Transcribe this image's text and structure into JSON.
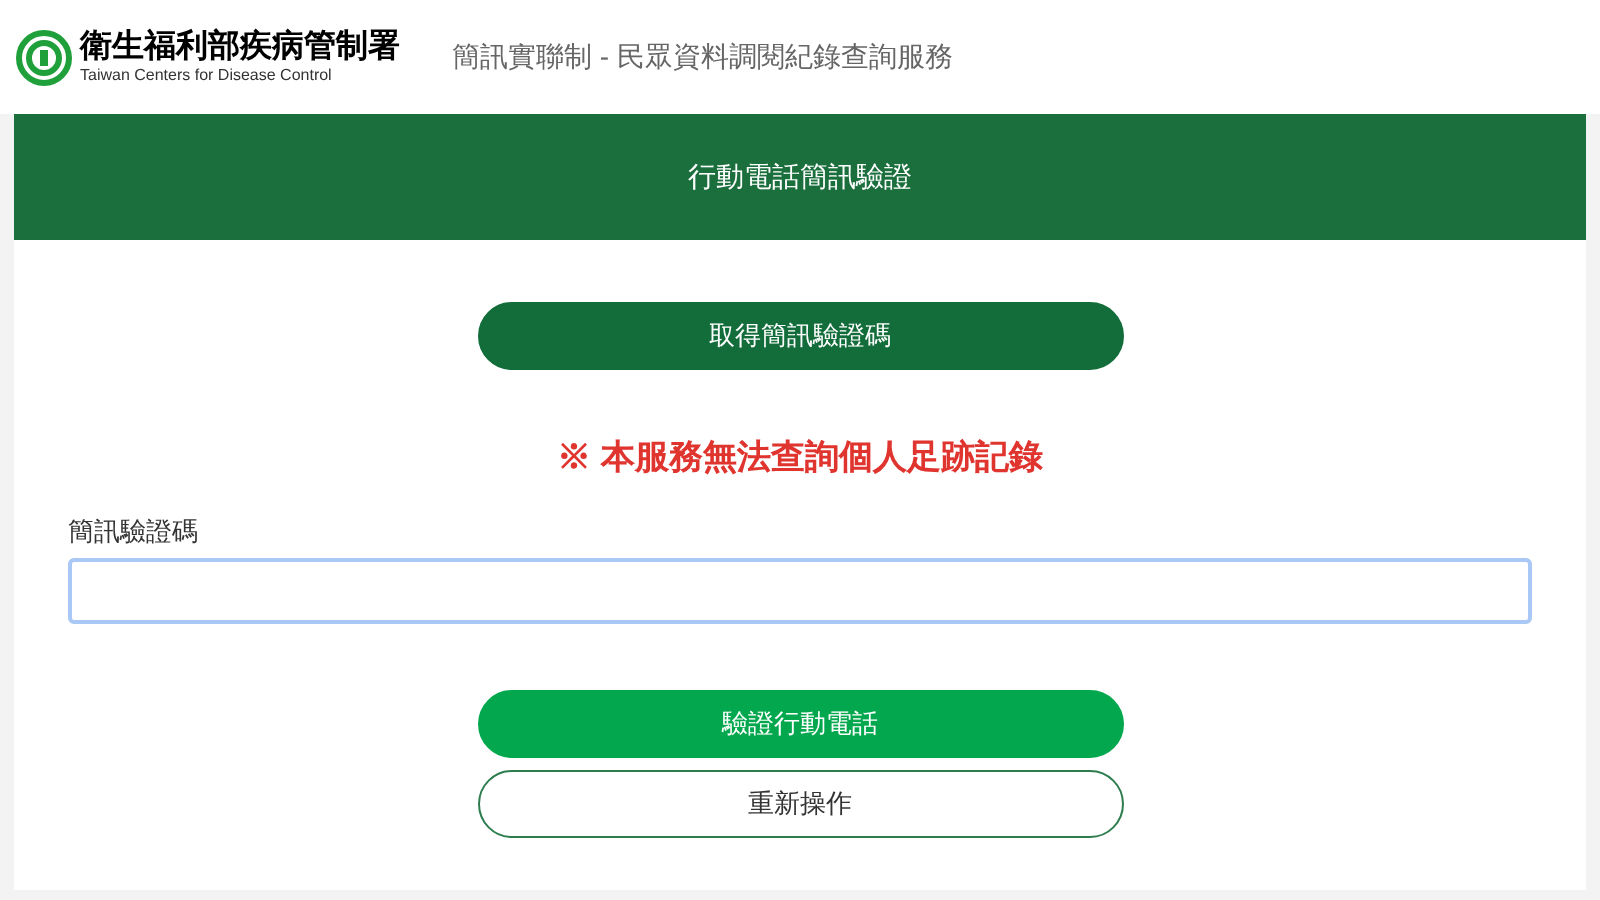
{
  "header": {
    "org_name": "衛生福利部疾病管制署",
    "org_name_en": "Taiwan Centers for Disease Control",
    "title": "簡訊實聯制 - 民眾資料調閱紀錄查詢服務"
  },
  "panel": {
    "title": "行動電話簡訊驗證",
    "top_button": {
      "label": "取得簡訊驗證碼",
      "kind": "dark"
    },
    "notice": "※ 本服務無法查詢個人足跡記錄",
    "field": {
      "label": "簡訊驗證碼"
    },
    "buttons": [
      {
        "label": "驗證行動電話",
        "kind": "primary"
      },
      {
        "label": "重新操作",
        "kind": "outline"
      }
    ]
  }
}
